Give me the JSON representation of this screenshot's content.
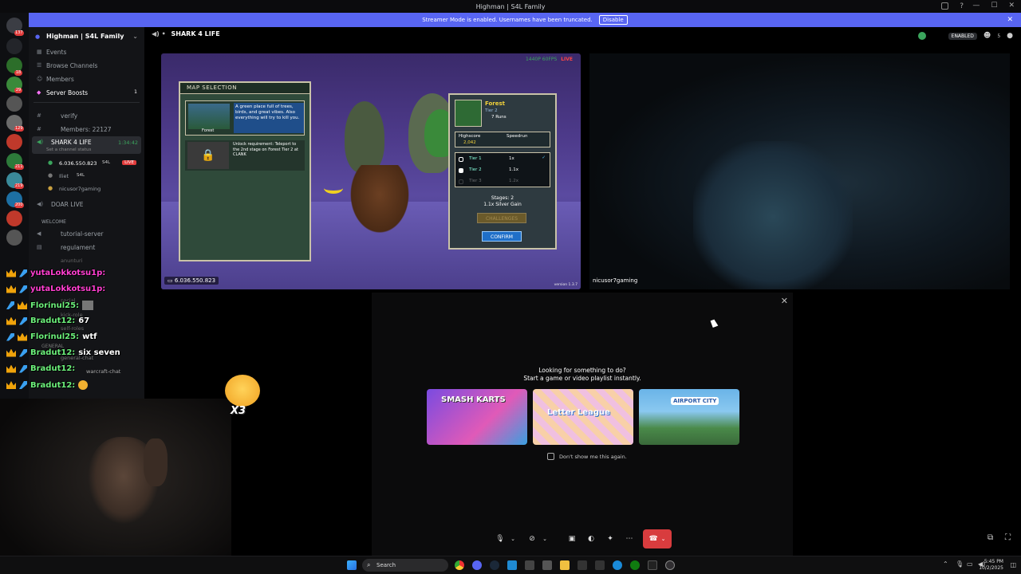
{
  "titlebar": {
    "title": "Highman | S4L Family"
  },
  "banner": {
    "text": "Streamer Mode is enabled. Usernames have been truncated.",
    "button": "Disable"
  },
  "guild_badges": [
    "137",
    "18",
    "29",
    "129",
    "211",
    "219",
    "200"
  ],
  "sidebar": {
    "server_name": "Highman | S4L Family",
    "top_items": [
      "Events",
      "Browse Channels",
      "Members",
      "Server Boosts"
    ],
    "boost_count": "1",
    "channels": [
      {
        "name": "verify"
      },
      {
        "name": "Members: 22127"
      },
      {
        "name": "SHARK 4 LIFE",
        "sub": "Set a channel status",
        "time": "1:34:42"
      },
      {
        "name": "DOAR LIVE"
      }
    ],
    "voice_users": [
      {
        "name": "6.036.550.823",
        "tag": "S4L",
        "live": "LIVE"
      },
      {
        "name": "Iliet",
        "tag": "S4L"
      },
      {
        "name": "nicusor7gaming"
      }
    ],
    "category_welcome": "WELCOME",
    "welcome_channels": [
      "tutorial-server",
      "regulament"
    ],
    "category_general": "GENERAL",
    "faded_channels": [
      "anunturi",
      "social",
      "kick-role",
      "self-roles",
      "general-chat",
      "warcraft-chat"
    ]
  },
  "header": {
    "channel": "SHARK 4 LIFE",
    "enabled": "ENABLED",
    "count": "5"
  },
  "stream": {
    "quality": "1440P 60FPS",
    "live": "LIVE",
    "user": "6.036.550.823",
    "version": "version 1.3.7",
    "map_panel_title": "MAP SELECTION",
    "map_desc": "A green place full of trees, birds, and great vibes. Also everything will try to kill you.",
    "map_name": "Forest",
    "unlock_text": "Unlock requirement: Teleport to the 2nd stage on Forest Tier 2 at CLANK",
    "detail_name": "Forest",
    "detail_tier": "Tier 2",
    "detail_runs": "7 Runs",
    "highscore_label": "Highscore",
    "speedrun_label": "Speedrun",
    "highscore_value": "2,042",
    "tiers": [
      {
        "name": "Tier 1",
        "mult": "1x"
      },
      {
        "name": "Tier 2",
        "mult": "1.1x"
      },
      {
        "name": "Tier 3",
        "mult": "1.2x"
      }
    ],
    "stages": "Stages: 2",
    "silver_gain": "1.1x Silver Gain",
    "challenges": "CHALLENGES",
    "confirm": "CONFIRM"
  },
  "cam_user": "nicusor7gaming",
  "activity": {
    "title_line1": "Looking for something to do?",
    "title_line2": "Start a game or video playlist instantly.",
    "games": [
      "SMASH KARTS",
      "Letter League",
      "AIRPORT CITY"
    ],
    "dont_show": "Don't show me this again."
  },
  "chat": [
    {
      "user": "yutaLokkotsu1p:",
      "msg": "",
      "color": "#ff3fd0"
    },
    {
      "user": "yutaLokkotsu1p:",
      "msg": "",
      "color": "#ff3fd0"
    },
    {
      "user": "Florinul25:",
      "msg": "",
      "color": "#6cf07b"
    },
    {
      "user": "Bradut12:",
      "msg": "67",
      "color": "#6cf07b"
    },
    {
      "user": "Florinul25:",
      "msg": "wtf",
      "color": "#6cf07b"
    },
    {
      "user": "Bradut12:",
      "msg": "six seven",
      "color": "#6cf07b"
    },
    {
      "user": "Bradut12:",
      "msg": "",
      "color": "#6cf07b"
    },
    {
      "user": "Bradut12:",
      "msg": "",
      "color": "#6cf07b"
    }
  ],
  "emote_text": "X3",
  "taskbar": {
    "search": "Search",
    "time": "5:45 PM",
    "date": "10/2/2025"
  }
}
